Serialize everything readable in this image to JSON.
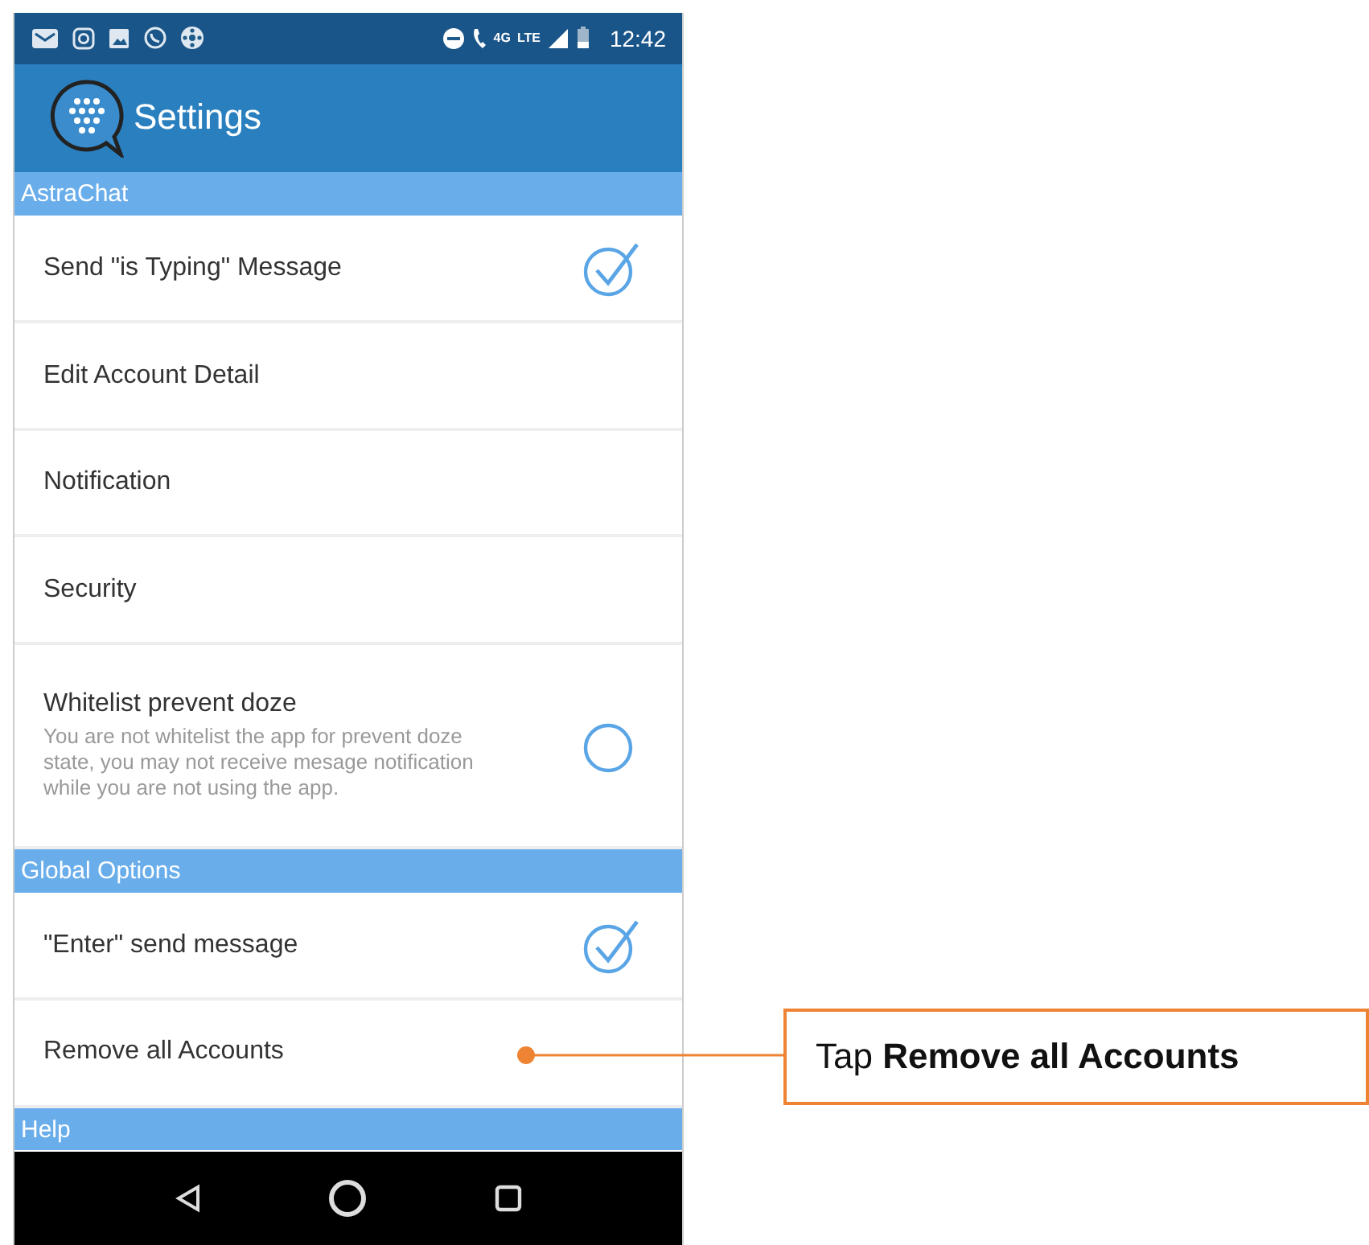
{
  "status_bar": {
    "network_badge": "4G",
    "network_type": "LTE",
    "time": "12:42"
  },
  "app_bar": {
    "title": "Settings"
  },
  "sections": [
    {
      "header": "AstraChat",
      "items": [
        {
          "kind": "checkbox",
          "label": "Send \"is Typing\" Message",
          "checked": true
        },
        {
          "kind": "plain",
          "label": "Edit Account Detail"
        },
        {
          "kind": "plain",
          "label": "Notification"
        },
        {
          "kind": "plain",
          "label": "Security"
        },
        {
          "kind": "checkbox",
          "label": "Whitelist prevent doze",
          "summary": "You are not whitelist the app for prevent doze state, you may not receive mesage notification while you are not using the app.",
          "checked": false
        }
      ]
    },
    {
      "header": "Global Options",
      "items": [
        {
          "kind": "checkbox",
          "label": "\"Enter\" send message",
          "checked": true
        },
        {
          "kind": "plain",
          "label": "Remove all Accounts"
        }
      ]
    },
    {
      "header": "Help"
    }
  ],
  "callout": {
    "text": "Tap **Remove all Accounts**"
  }
}
